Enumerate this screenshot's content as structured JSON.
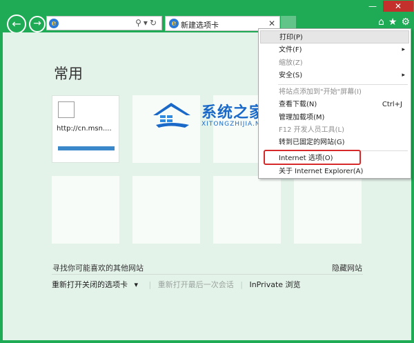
{
  "window": {
    "minimize_icon": "minimize-icon",
    "minimize_glyph": "—",
    "close_icon": "close-icon",
    "close_glyph": "✕"
  },
  "nav": {
    "back_icon": "back-arrow-icon",
    "back_glyph": "←",
    "forward_icon": "forward-arrow-icon",
    "forward_glyph": "→"
  },
  "address_bar": {
    "value": "",
    "search_icon": "search-icon",
    "dropdown_icon": "dropdown-icon",
    "refresh_icon": "refresh-icon",
    "icons_glyph": "⚲▾↻"
  },
  "tab": {
    "title": "新建选项卡",
    "close_glyph": "✕"
  },
  "toolbar_right": {
    "home_glyph": "⌂",
    "favorites_glyph": "★",
    "tools_glyph": "⚙"
  },
  "page": {
    "heading": "常用",
    "tiles": [
      {
        "label": "http://cn.msn...."
      },
      {
        "label": ""
      },
      {
        "label": ""
      },
      {
        "label": ""
      },
      {
        "label": ""
      },
      {
        "label": ""
      },
      {
        "label": ""
      },
      {
        "label": ""
      }
    ],
    "discover_text": "寻找你可能喜欢的其他网站",
    "hide_sites": "隐藏网站",
    "reopen_closed": "重新打开关闭的选项卡",
    "reopen_closed_arrow": "▾",
    "reopen_last_session": "重新打开最后一次会话",
    "separator": "|",
    "inprivate": "InPrivate 浏览"
  },
  "watermark": {
    "title": "系统之家",
    "subtitle": "XITONGZHIJIA.NET"
  },
  "tools_menu": {
    "items": [
      {
        "label": "打印(P)",
        "accel": "",
        "submenu": true,
        "disabled": false,
        "hover": true
      },
      {
        "label": "文件(F)",
        "accel": "",
        "submenu": true,
        "disabled": false,
        "hover": false
      },
      {
        "label": "缩放(Z)",
        "accel": "",
        "submenu": false,
        "disabled": true,
        "hover": false
      },
      {
        "label": "安全(S)",
        "accel": "",
        "submenu": true,
        "disabled": false,
        "hover": false
      },
      {
        "label": "将站点添加到\"开始\"屏幕(I)",
        "accel": "",
        "submenu": false,
        "disabled": true,
        "hover": false
      },
      {
        "label": "查看下载(N)",
        "accel": "Ctrl+J",
        "submenu": false,
        "disabled": false,
        "hover": false
      },
      {
        "label": "管理加载项(M)",
        "accel": "",
        "submenu": false,
        "disabled": false,
        "hover": false
      },
      {
        "label": "F12 开发人员工具(L)",
        "accel": "",
        "submenu": false,
        "disabled": true,
        "hover": false
      },
      {
        "label": "转到已固定的网站(G)",
        "accel": "",
        "submenu": false,
        "disabled": false,
        "hover": false
      },
      {
        "label": "Internet 选项(O)",
        "accel": "",
        "submenu": false,
        "disabled": false,
        "hover": false
      },
      {
        "label": "关于 Internet Explorer(A)",
        "accel": "",
        "submenu": false,
        "disabled": false,
        "hover": false
      }
    ],
    "submenu_glyph": "▸"
  },
  "colors": {
    "frame": "#1faa55",
    "close_button": "#c4302b",
    "page_background": "#e4f3ea",
    "highlight_box": "#d62828",
    "watermark_blue": "#1a69c8"
  }
}
